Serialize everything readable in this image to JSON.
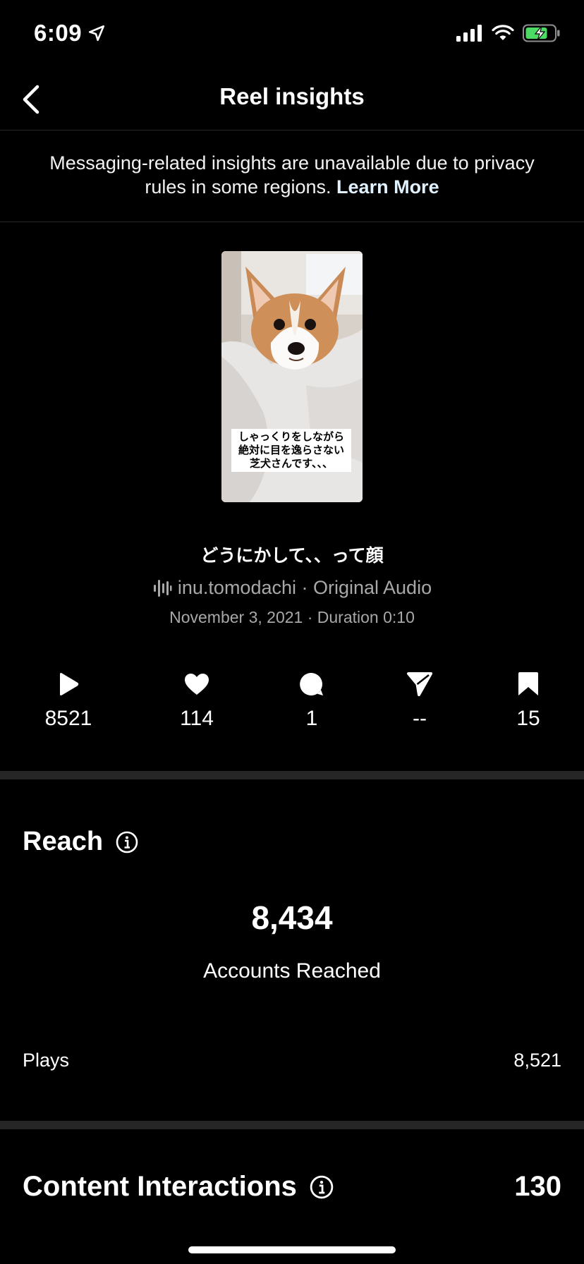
{
  "status_bar": {
    "time": "6:09"
  },
  "header": {
    "title": "Reel insights",
    "back_icon": "chevron-left-icon"
  },
  "notice": {
    "text": "Messaging-related insights are unavailable due to privacy rules in some regions.",
    "link": "Learn More"
  },
  "reel": {
    "thumbnail_caption": "しゃっくりをしながら\n絶対に目を逸らさない\n芝犬さんです、、、",
    "title": "どうにかして、、って顔",
    "audio_icon": "audio-waveform-icon",
    "audio": "inu.tomodachi · Original Audio",
    "date_duration": "November 3, 2021 · Duration 0:10"
  },
  "stats": [
    {
      "icon": "play-icon",
      "value": "8521"
    },
    {
      "icon": "heart-icon",
      "value": "114"
    },
    {
      "icon": "comment-icon",
      "value": "1"
    },
    {
      "icon": "send-icon",
      "value": "--"
    },
    {
      "icon": "bookmark-icon",
      "value": "15"
    }
  ],
  "reach": {
    "title": "Reach",
    "accounts_reached_value": "8,434",
    "accounts_reached_label": "Accounts Reached",
    "plays_label": "Plays",
    "plays_value": "8,521"
  },
  "content_interactions": {
    "title": "Content Interactions",
    "value": "130"
  },
  "colors": {
    "background": "#000000",
    "text": "#ffffff",
    "secondary_text": "#a8a8a8",
    "divider": "#262626",
    "battery_green": "#4cd964"
  }
}
